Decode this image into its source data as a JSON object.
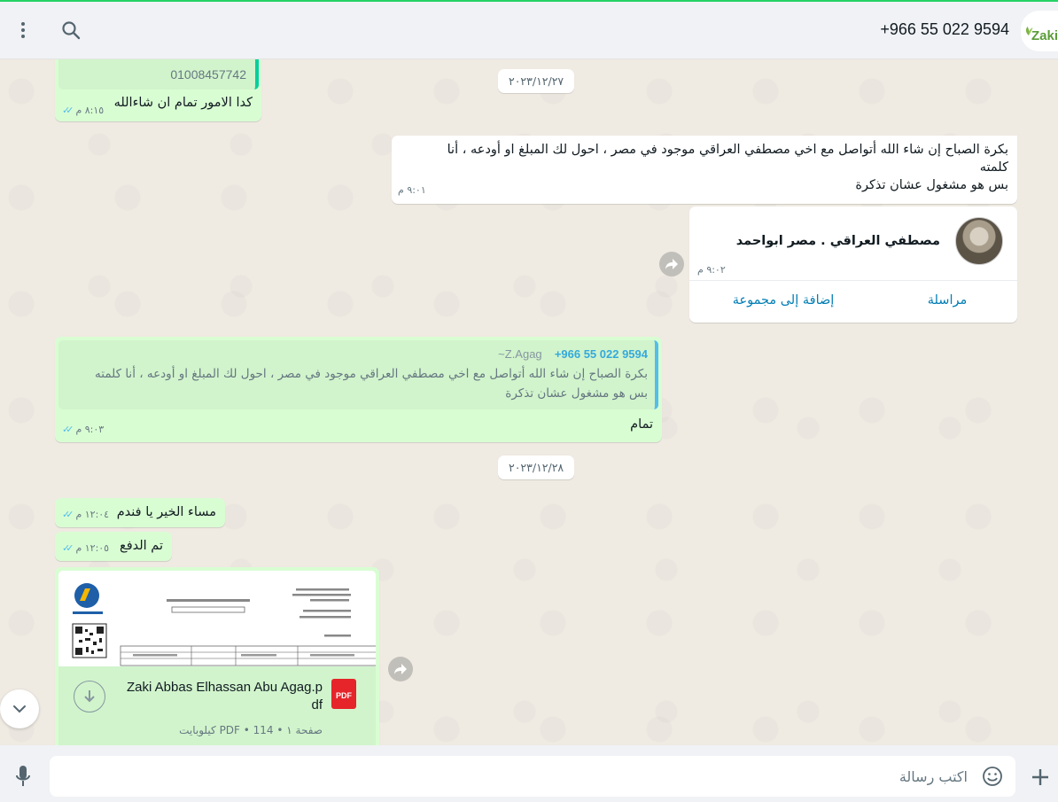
{
  "header": {
    "contact_name": "+966 55 022 9594",
    "logo_text": "Zaki",
    "menu_icon": "kebab-menu-icon",
    "search_icon": "search-icon"
  },
  "messages": {
    "m0_phone": "01008457742",
    "m0_text": "كدا الامور تمام ان شاءالله",
    "m0_time": "٨:١٥ م",
    "date1": "٢٠٢٣/١٢/٢٧",
    "m1_line1": "بكرة الصباح إن شاء الله أتواصل مع اخي مصطفي العراقي موجود في مصر ، احول لك المبلغ او أودعه ، أنا",
    "m1_line2": "كلمته",
    "m1_line3": "بس هو مشغول عشان تذكرة",
    "m1_time": "٩:٠١ م",
    "contact_card_name": "مصطفي العراقي . مصر ابواحمد",
    "contact_card_time": "٩:٠٢ م",
    "contact_card_message": "مراسلة",
    "contact_card_add_group": "إضافة إلى مجموعة",
    "m2_quote_sender": "+966 55 022 9594",
    "m2_quote_alias": "~Z.Agag",
    "m2_quote_line1": "بكرة الصباح إن شاء الله أتواصل مع اخي مصطفي العراقي موجود في مصر ، احول لك المبلغ او أودعه ، أنا كلمته",
    "m2_quote_line2": "بس هو مشغول عشان تذكرة",
    "m2_text": "تمام",
    "m2_time": "٩:٠٣ م",
    "date2": "٢٠٢٣/١٢/٢٨",
    "m3_text": "مساء الخير يا فندم",
    "m3_time": "١٢:٠٤ م",
    "m4_text": "تم الدفع",
    "m4_time": "١٢:٠٥ م",
    "doc_name_line1": "Zaki Abbas Elhassan Abu Agag.p",
    "doc_name_line2": "df",
    "doc_meta": "صفحة ١ • PDF • 114 كيلوبايت",
    "doc_badge": "PDF"
  },
  "composer": {
    "placeholder": "اكتب رسالة"
  },
  "colors": {
    "outgoing": "#d9fdd3",
    "incoming": "#ffffff",
    "accent": "#25d366",
    "quote_bar": "#53bdeb"
  }
}
